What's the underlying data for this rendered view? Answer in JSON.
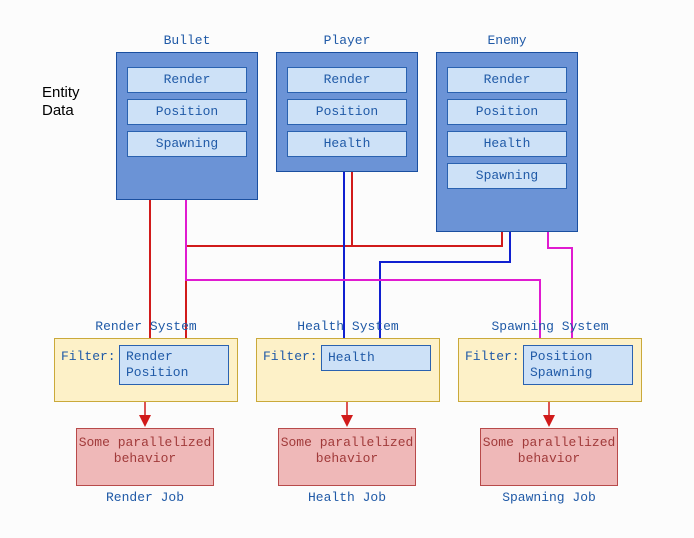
{
  "side_label_line1": "Entity",
  "side_label_line2": "Data",
  "entities": {
    "bullet": {
      "title": "Bullet",
      "comps": [
        "Render",
        "Position",
        "Spawning"
      ]
    },
    "player": {
      "title": "Player",
      "comps": [
        "Render",
        "Position",
        "Health"
      ]
    },
    "enemy": {
      "title": "Enemy",
      "comps": [
        "Render",
        "Position",
        "Health",
        "Spawning"
      ]
    }
  },
  "systems": {
    "render": {
      "title": "Render System",
      "filter_label": "Filter:",
      "filter_items": [
        "Render",
        "Position"
      ]
    },
    "health": {
      "title": "Health System",
      "filter_label": "Filter:",
      "filter_items": [
        "Health"
      ]
    },
    "spawning": {
      "title": "Spawning System",
      "filter_label": "Filter:",
      "filter_items": [
        "Position",
        "Spawning"
      ]
    }
  },
  "jobs": {
    "render": {
      "body": "Some parallelized behavior",
      "label": "Render Job"
    },
    "health": {
      "body": "Some parallelized behavior",
      "label": "Health Job"
    },
    "spawning": {
      "body": "Some parallelized behavior",
      "label": "Spawning Job"
    }
  },
  "colors": {
    "red": "#d11b1b",
    "blue": "#1020d0",
    "magenta": "#e01bd0"
  }
}
